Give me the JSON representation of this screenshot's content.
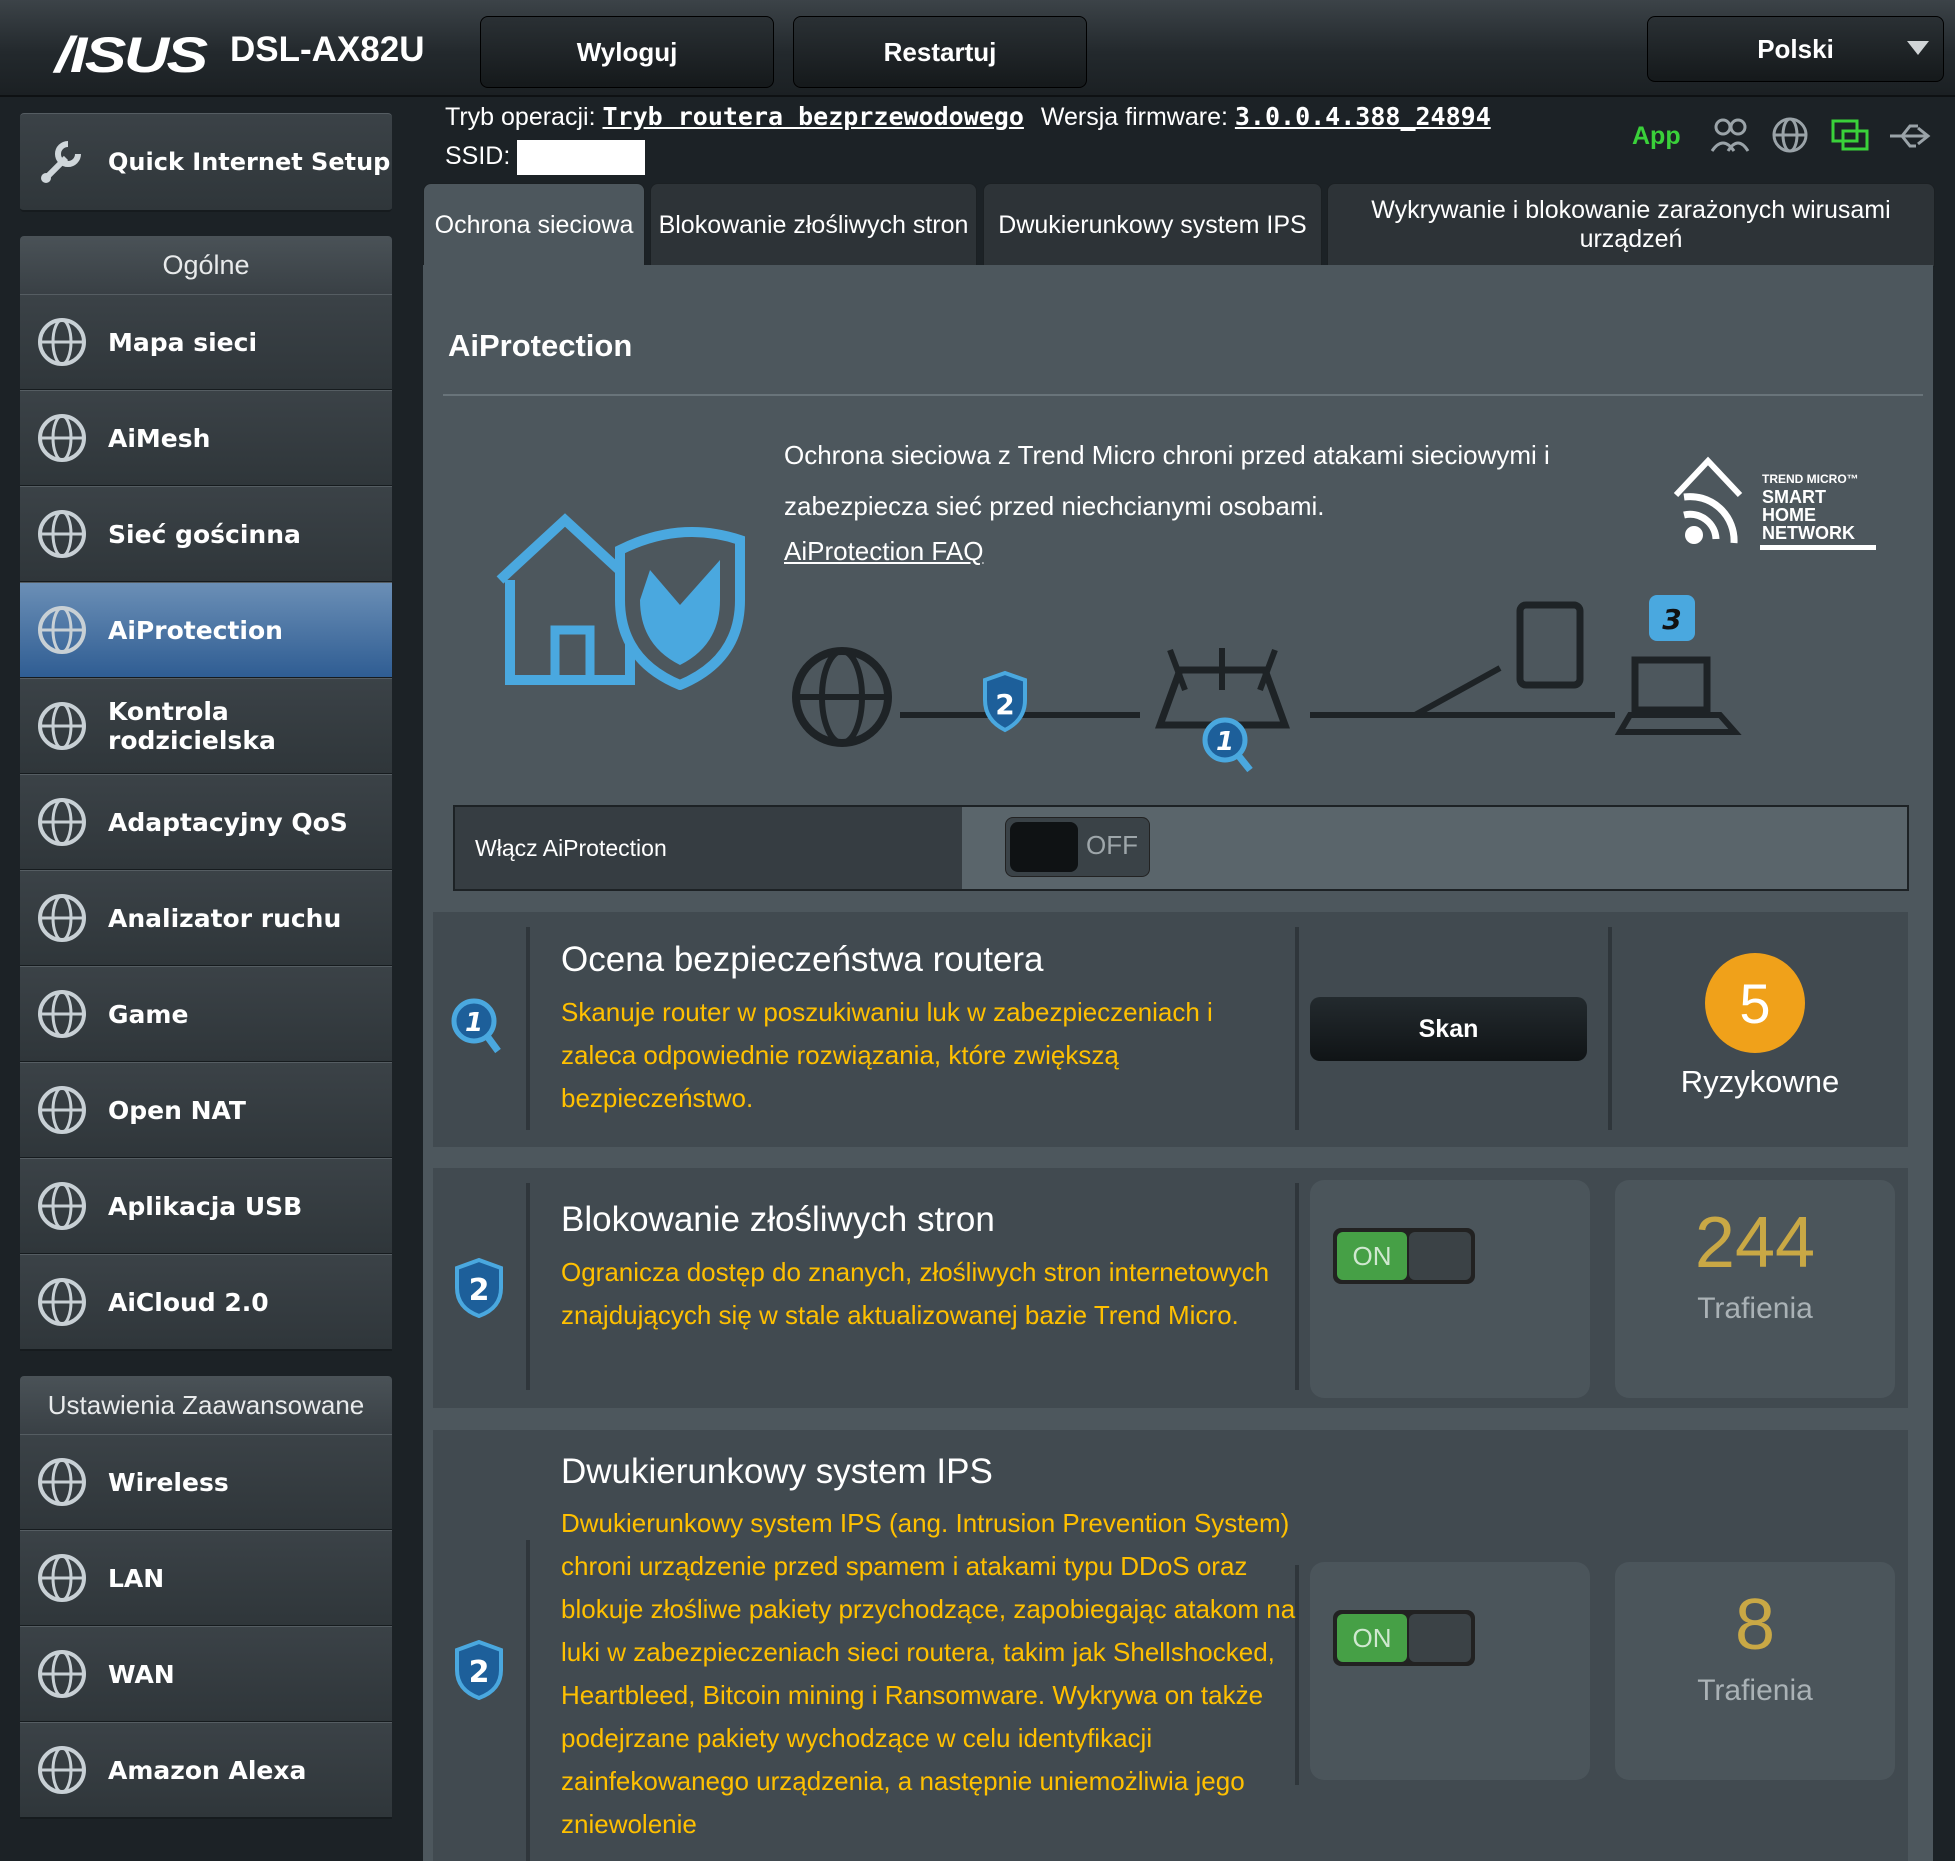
{
  "header": {
    "logo": "/ISUS",
    "model": "DSL-AX82U",
    "logout_label": "Wyloguj",
    "restart_label": "Restartuj",
    "language": "Polski"
  },
  "info": {
    "mode_label": "Tryb operacji:",
    "mode_value": "Tryb routera bezprzewodowego",
    "firmware_label": "Wersja firmware:",
    "firmware_value": "3.0.0.4.388_24894",
    "ssid_label": "SSID:",
    "app_label": "App"
  },
  "sidebar": {
    "quick_setup": "Quick Internet Setup",
    "general_header": "Ogólne",
    "general_items": [
      {
        "label": "Mapa sieci",
        "icon": "network-map-icon"
      },
      {
        "label": "AiMesh",
        "icon": "aimesh-icon"
      },
      {
        "label": "Sieć gościnna",
        "icon": "guest-network-icon"
      },
      {
        "label": "AiProtection",
        "icon": "aiprotection-icon",
        "active": true
      },
      {
        "label": "Kontrola rodzicielska",
        "icon": "parental-control-icon"
      },
      {
        "label": "Adaptacyjny QoS",
        "icon": "qos-icon"
      },
      {
        "label": "Analizator ruchu",
        "icon": "traffic-analyzer-icon"
      },
      {
        "label": "Game",
        "icon": "gamepad-icon"
      },
      {
        "label": "Open NAT",
        "icon": "open-nat-icon"
      },
      {
        "label": "Aplikacja USB",
        "icon": "usb-app-icon"
      },
      {
        "label": "AiCloud 2.0",
        "icon": "aicloud-icon"
      }
    ],
    "advanced_header": "Ustawienia Zaawansowane",
    "advanced_items": [
      {
        "label": "Wireless",
        "icon": "wireless-icon"
      },
      {
        "label": "LAN",
        "icon": "lan-icon"
      },
      {
        "label": "WAN",
        "icon": "wan-icon"
      },
      {
        "label": "Amazon Alexa",
        "icon": "alexa-icon"
      }
    ]
  },
  "tabs": [
    {
      "label": "Ochrona sieciowa",
      "active": true
    },
    {
      "label": "Blokowanie złośliwych stron"
    },
    {
      "label": "Dwukierunkowy system IPS"
    },
    {
      "label": "Wykrywanie i blokowanie zarażonych wirusami urządzeń"
    }
  ],
  "main": {
    "title": "AiProtection",
    "intro": "Ochrona sieciowa z Trend Micro chroni przed atakami sieciowymi i zabezpiecza sieć przed niechcianymi osobami.",
    "faq_link": "AiProtection FAQ",
    "trend_logo": [
      "TREND MICRO™",
      "SMART",
      "HOME",
      "NETWORK"
    ],
    "diagram_badges": [
      "1",
      "2",
      "3"
    ],
    "enable_label": "Włącz AiProtection",
    "enable_state": "OFF"
  },
  "cards": [
    {
      "badge": "1",
      "title": "Ocena bezpieczeństwa routera",
      "desc": "Skanuje router w poszukiwaniu luk w zabezpieczeniach i zaleca odpowiednie rozwiązania, które zwiększą bezpieczeństwo.",
      "button": "Skan",
      "score": "5",
      "score_label": "Ryzykowne"
    },
    {
      "badge": "2",
      "title": "Blokowanie złośliwych stron",
      "desc": "Ogranicza dostęp do znanych, złośliwych stron internetowych znajdujących się w stale aktualizowanej bazie Trend Micro.",
      "toggle": "ON",
      "count": "244",
      "count_label": "Trafienia"
    },
    {
      "badge": "2",
      "title": "Dwukierunkowy system IPS",
      "desc": "Dwukierunkowy system IPS (ang. Intrusion Prevention System) chroni urządzenie przed spamem i atakami typu DDoS oraz blokuje złośliwe pakiety przychodzące, zapobiegając atakom na luki w zabezpieczeniach sieci routera, takim jak Shellshocked, Heartbleed, Bitcoin mining i Ransomware. Wykrywa on także podejrzane pakiety wychodzące w celu identyfikacji zainfekowanego urządzenia, a następnie uniemożliwia jego zniewolenie",
      "toggle": "ON",
      "count": "8",
      "count_label": "Trafienia"
    }
  ],
  "colors": {
    "accent_blue": "#2f5d93",
    "desc_yellow": "#ffc000",
    "score_orange": "#f0a11a",
    "on_green": "#46a046",
    "app_green": "#3ad13a"
  }
}
